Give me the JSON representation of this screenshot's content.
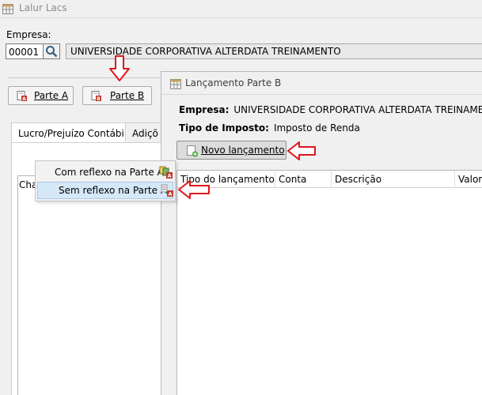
{
  "window": {
    "title": "Lalur Lacs"
  },
  "empresa": {
    "label": "Empresa:",
    "code": "00001",
    "name": "UNIVERSIDADE CORPORATIVA ALTERDATA TREINAMENTO"
  },
  "toolbar": {
    "parte_a": "Parte A",
    "parte_b": "Parte B"
  },
  "tabs": [
    "Lucro/Prejuízo Contábil",
    "Adiçõ"
  ],
  "list": {
    "header": "Cha"
  },
  "context_menu": {
    "items": [
      "Com reflexo na Parte A",
      "Sem reflexo na Parte A"
    ]
  },
  "dialog": {
    "title": "Lançamento Parte B",
    "empresa_label": "Empresa:",
    "empresa_value": "UNIVERSIDADE CORPORATIVA ALTERDATA TREINAMENTO",
    "imposto_label": "Tipo de Imposto:",
    "imposto_value": "Imposto de Renda",
    "new_button": "Novo lançamento",
    "columns": [
      "Tipo do lançamento",
      "Conta",
      "Descrição",
      "Valor"
    ]
  },
  "colors": {
    "annotation_arrow": "#e0141e",
    "menu_highlight": "#d5e8f8"
  }
}
